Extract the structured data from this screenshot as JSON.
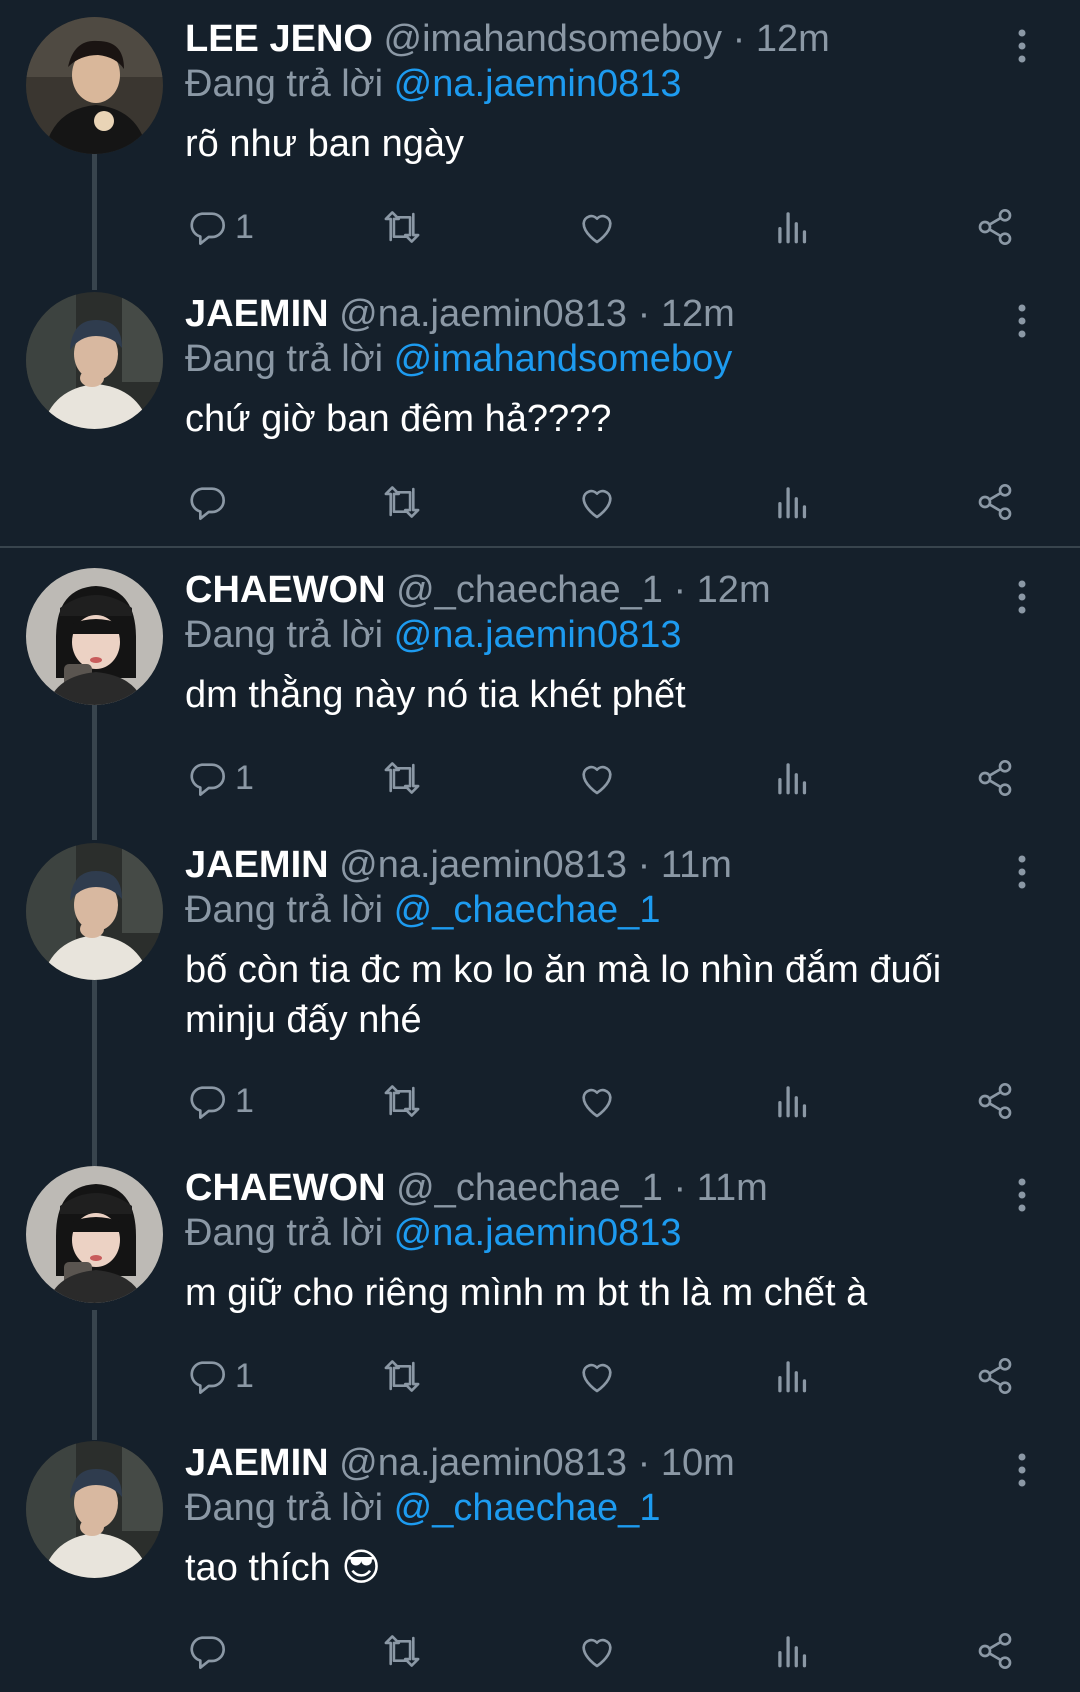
{
  "colors": {
    "background": "#15202b",
    "text": "#ffffff",
    "muted": "#8b98a5",
    "link": "#1d9bf0",
    "thread_line": "#38444d"
  },
  "reply_prefix": "Đang trả lời",
  "dot": "·",
  "tweets": [
    {
      "name": "LEE JENO",
      "handle": "@imahandsomeboy",
      "time": "12m",
      "reply_to": "@na.jaemin0813",
      "text": "rõ như ban ngày",
      "reply_count": "1",
      "avatar": "avatar-jeno"
    },
    {
      "name": "JAEMIN",
      "handle": "@na.jaemin0813",
      "time": "12m",
      "reply_to": "@imahandsomeboy",
      "text": "chứ giờ ban đêm hả????",
      "reply_count": "",
      "avatar": "avatar-jaemin"
    },
    {
      "name": "CHAEWON",
      "handle": "@_chaechae_1",
      "time": "12m",
      "reply_to": "@na.jaemin0813",
      "text": "dm thằng này nó tia khét phết",
      "reply_count": "1",
      "avatar": "avatar-chaewon"
    },
    {
      "name": "JAEMIN",
      "handle": "@na.jaemin0813",
      "time": "11m",
      "reply_to": "@_chaechae_1",
      "text": "bố còn tia đc m ko lo ăn mà lo nhìn đắm đuối minju đấy nhé",
      "reply_count": "1",
      "avatar": "avatar-jaemin"
    },
    {
      "name": "CHAEWON",
      "handle": "@_chaechae_1",
      "time": "11m",
      "reply_to": "@na.jaemin0813",
      "text": "m giữ cho riêng mình m bt th là m chết à",
      "reply_count": "1",
      "avatar": "avatar-chaewon"
    },
    {
      "name": "JAEMIN",
      "handle": "@na.jaemin0813",
      "time": "10m",
      "reply_to": "@_chaechae_1",
      "text": "tao thích 😎",
      "reply_count": "",
      "avatar": "avatar-jaemin"
    }
  ]
}
